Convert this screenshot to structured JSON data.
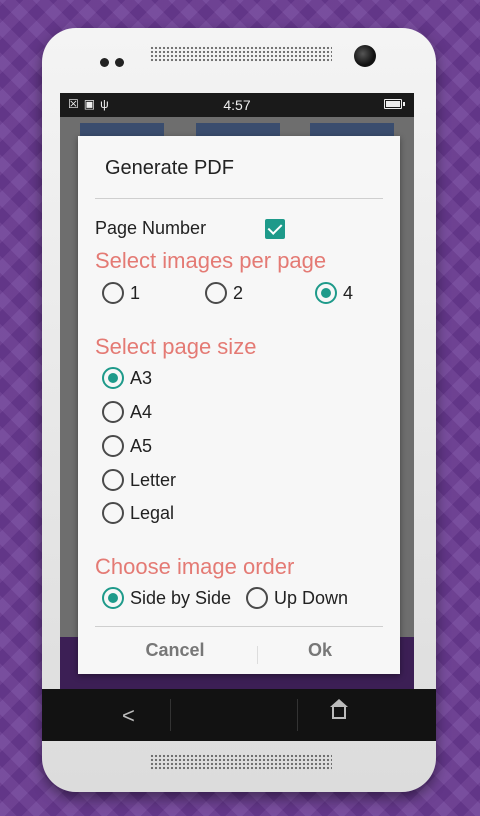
{
  "status_bar": {
    "time": "4:57",
    "icons": [
      "close-box-icon",
      "image-icon",
      "usb-icon",
      "battery-icon"
    ]
  },
  "dialog": {
    "title": "Generate PDF",
    "page_number": {
      "label": "Page Number",
      "checked": true
    },
    "images_per_page": {
      "heading": "Select images per page",
      "options": [
        {
          "label": "1",
          "selected": false
        },
        {
          "label": "2",
          "selected": false
        },
        {
          "label": "4",
          "selected": true
        }
      ]
    },
    "page_size": {
      "heading": "Select page size",
      "options": [
        {
          "label": "A3",
          "selected": true
        },
        {
          "label": "A4",
          "selected": false
        },
        {
          "label": "A5",
          "selected": false
        },
        {
          "label": "Letter",
          "selected": false
        },
        {
          "label": "Legal",
          "selected": false
        }
      ]
    },
    "image_order": {
      "heading": "Choose image order",
      "options": [
        {
          "label": "Side by Side",
          "selected": true
        },
        {
          "label": "Up Down",
          "selected": false
        }
      ]
    },
    "buttons": {
      "cancel": "Cancel",
      "ok": "Ok"
    }
  },
  "colors": {
    "accent": "#1e9a8a",
    "heading": "#e47a74",
    "background": "#6a3a93"
  }
}
